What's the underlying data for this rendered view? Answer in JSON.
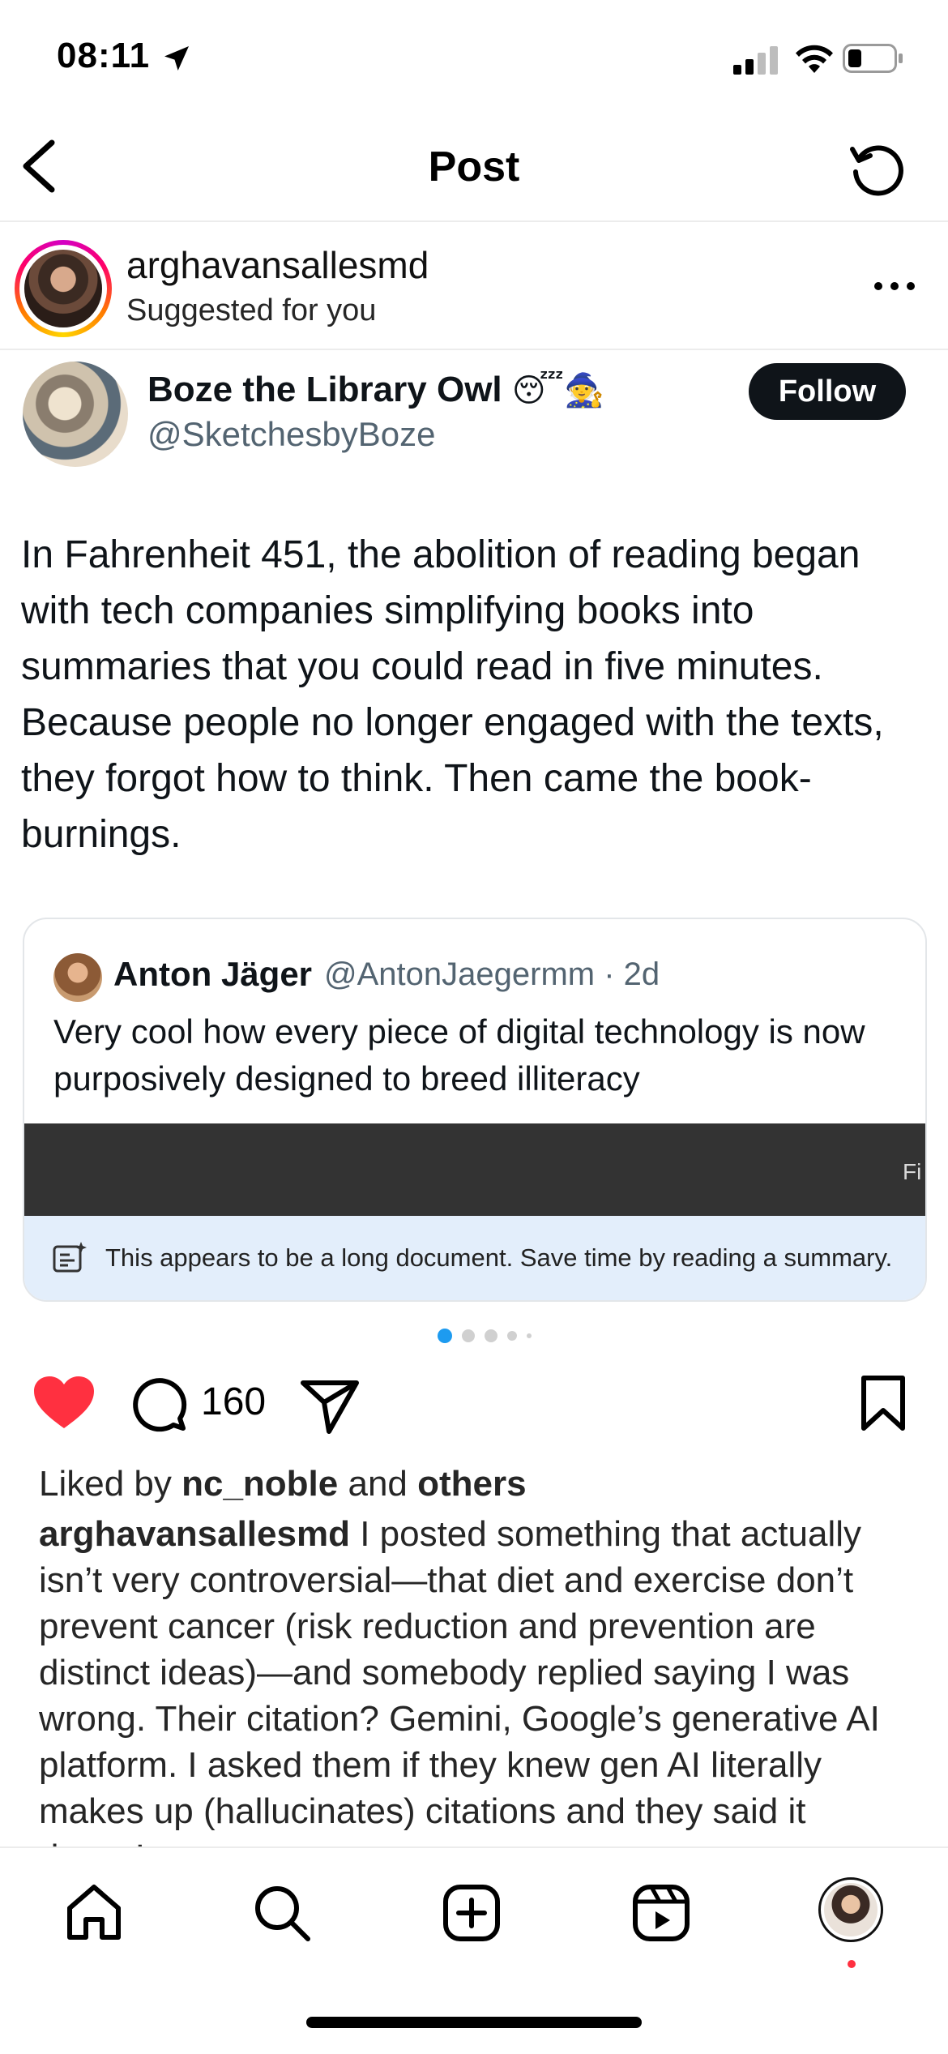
{
  "status_bar": {
    "time": "08:11"
  },
  "nav": {
    "title": "Post"
  },
  "post": {
    "author": "arghavansallesmd",
    "subtitle": "Suggested for you",
    "tweet": {
      "name": "Boze the Library Owl",
      "emoji": "😴🧙",
      "handle": "@SketchesbyBoze",
      "follow_label": "Follow",
      "text": "In Fahrenheit 451, the abolition of reading began with tech companies simplifying books into summaries that you could read in five minutes. Because people no longer engaged with the texts, they forgot how to think. Then came the book-burnings.",
      "quote": {
        "name": "Anton Jäger",
        "meta": "@AntonJaegermm · 2d",
        "text": "Very cool how every piece of digital technology is now purposively designed to breed illiteracy",
        "dark_bar_text": "Fi",
        "summary_notice": "This appears to be a long document. Save time by reading a summary."
      }
    },
    "carousel": {
      "count": 5,
      "active": 0
    },
    "actions": {
      "comment_count": "160",
      "liked": true
    },
    "liked_by": {
      "prefix": "Liked by ",
      "user": "nc_noble",
      "middle": " and ",
      "others": "others"
    },
    "caption": {
      "user": "arghavansallesmd",
      "text": " I posted something that actually isn’t very controversial—that diet and exercise don’t prevent cancer (risk reduction and prevention are distinct ideas)—and somebody replied saying I was wrong. Their citation? Gemini, Google’s generative AI platform. I asked them if they knew gen AI literally makes up (hallucinates) citations and they said it doesn’t"
    }
  },
  "tab_bar": {
    "items": [
      "home-icon",
      "search-icon",
      "create-icon",
      "reels-icon",
      "profile-avatar"
    ]
  },
  "colors": {
    "like": "#ff3040",
    "follow_bg": "#0f1419",
    "summary_bg": "#e3eefb",
    "dot_active": "#1d9bf0"
  }
}
